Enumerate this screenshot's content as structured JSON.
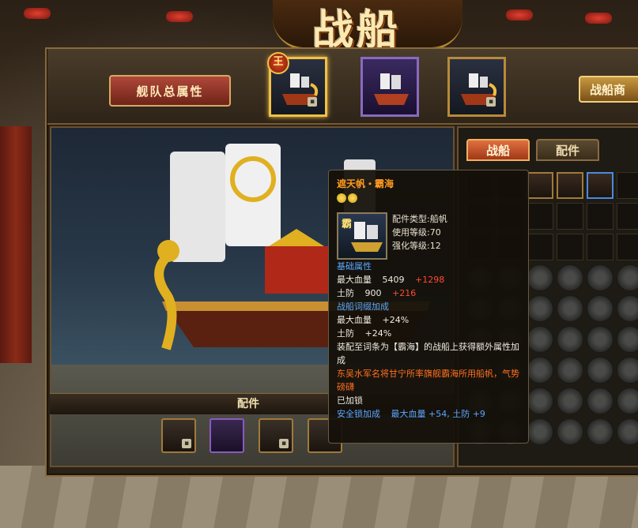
{
  "header": {
    "title": "战船"
  },
  "topbar": {
    "fleet_button": "舰队总属性",
    "king_badge": "王",
    "shop_button": "战船商"
  },
  "side_tabs": {
    "ship": "战船",
    "parts": "配件"
  },
  "accessories": {
    "label": "配件"
  },
  "tooltip": {
    "name": "遮天帆・霸海",
    "icon_char": "霸",
    "meta": {
      "type": "配件类型:船帆",
      "level": "使用等级:70",
      "enhance": "强化等级:12"
    },
    "base_header": "基础属性",
    "hp_label": "最大血量",
    "hp_value": "5409",
    "hp_bonus": "+1298",
    "def_label": "土防",
    "def_value": "900",
    "def_bonus": "+216",
    "affix_header": "战船词缀加成",
    "affix_hp": "最大血量",
    "affix_hp_value": "+24%",
    "affix_def": "土防",
    "affix_def_value": "+24%",
    "desc": "装配至词条为【霸海】的战船上获得额外属性加成",
    "lore": "东吴水军名将甘宁所率旗舰霸海所用船帆，气势磅礴",
    "locked": "已加锁",
    "lock_bonus_label": "安全锁加成",
    "lock_bonus_value": "最大血量 +54, 土防 +9"
  },
  "colors": {
    "title_orange": "#ff9a20",
    "blue_text": "#5aa8ff",
    "red_bonus": "#ff4a30",
    "lore_orange": "#ff7020"
  }
}
